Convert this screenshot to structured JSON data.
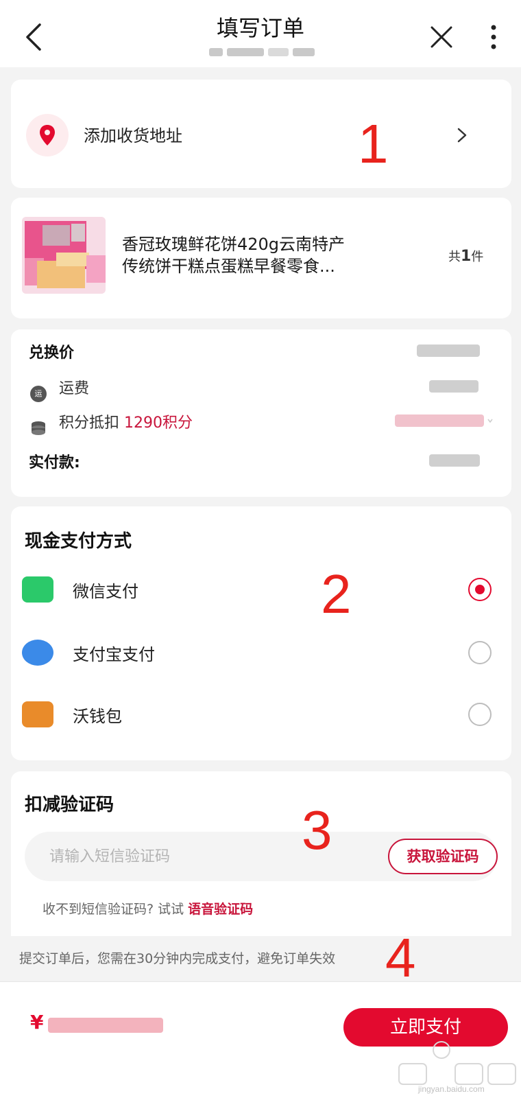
{
  "header": {
    "title": "填写订单"
  },
  "address": {
    "label": "添加收货地址"
  },
  "product": {
    "name_line1": "香冠玫瑰鲜花饼420g云南特产",
    "name_line2": "传统饼干糕点蛋糕早餐零食...",
    "count_prefix": "共",
    "count": "1",
    "count_suffix": "件"
  },
  "price": {
    "exchange_label": "兑换价",
    "shipping_label": "运费",
    "shipping_icon_text": "运",
    "points_label": "积分抵扣",
    "points_value": "1290积分",
    "actual_label": "实付款:"
  },
  "payment": {
    "title": "现金支付方式",
    "methods": [
      {
        "label": "微信支付",
        "icon": "wechat-pay-icon",
        "selected": true,
        "color": "#2bc96a"
      },
      {
        "label": "支付宝支付",
        "icon": "alipay-icon",
        "selected": false,
        "color": "#3b8ae8"
      },
      {
        "label": "沃钱包",
        "icon": "wo-wallet-icon",
        "selected": false,
        "color": "#e98b2a"
      }
    ]
  },
  "verify": {
    "title": "扣减验证码",
    "placeholder": "请输入短信验证码",
    "get_code": "获取验证码",
    "hint_prefix": "收不到短信验证码? 试试 ",
    "voice_code": "语音验证码"
  },
  "notice": "提交订单后，您需在30分钟内完成支付，避免订单失效",
  "footer": {
    "currency": "¥",
    "pay_button": "立即支付"
  },
  "annotations": [
    "1",
    "2",
    "3",
    "4"
  ],
  "watermark": {
    "site": "jingyan.baidu.com"
  },
  "colors": {
    "accent": "#e30a2f",
    "points": "#c8153b",
    "background": "#f3f3f3"
  }
}
